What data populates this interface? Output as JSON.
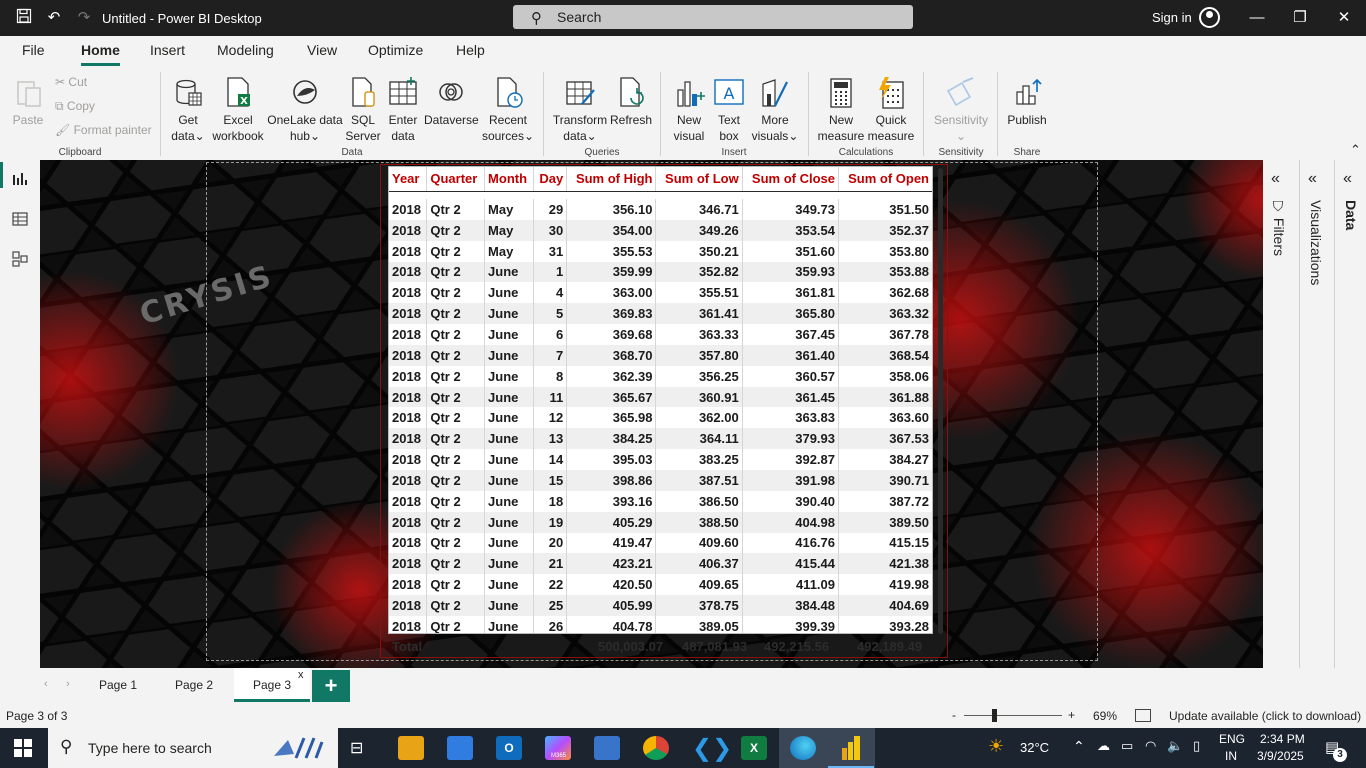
{
  "titlebar": {
    "app_title": "Untitled - Power BI Desktop",
    "search_placeholder": "Search",
    "sign_in": "Sign in"
  },
  "menu": {
    "tabs": [
      "File",
      "Home",
      "Insert",
      "Modeling",
      "View",
      "Optimize",
      "Help"
    ],
    "active": "Home"
  },
  "ribbon": {
    "clipboard": {
      "paste": "Paste",
      "cut": "Cut",
      "copy": "Copy",
      "format_painter": "Format painter",
      "label": "Clipboard"
    },
    "data": {
      "get_data": [
        "Get",
        "data"
      ],
      "excel": [
        "Excel",
        "workbook"
      ],
      "onelake": [
        "OneLake data",
        "hub"
      ],
      "sql": [
        "SQL",
        "Server"
      ],
      "enter": [
        "Enter",
        "data"
      ],
      "dataverse": [
        "Dataverse"
      ],
      "recent": [
        "Recent",
        "sources"
      ],
      "label": "Data"
    },
    "queries": {
      "transform": [
        "Transform",
        "data"
      ],
      "refresh": [
        "Refresh"
      ],
      "label": "Queries"
    },
    "insert": {
      "new_visual": [
        "New",
        "visual"
      ],
      "text_box": [
        "Text",
        "box"
      ],
      "more_visuals": [
        "More",
        "visuals"
      ],
      "label": "Insert"
    },
    "calculations": {
      "new_measure": [
        "New",
        "measure"
      ],
      "quick_measure": [
        "Quick",
        "measure"
      ],
      "label": "Calculations"
    },
    "sensitivity": {
      "sensitivity": [
        "Sensitivity"
      ],
      "label": "Sensitivity"
    },
    "share": {
      "publish": [
        "Publish"
      ],
      "label": "Share"
    }
  },
  "watermark": "CRYSIS",
  "table": {
    "columns": [
      "Year",
      "Quarter",
      "Month",
      "Day",
      "Sum of High",
      "Sum of Low",
      "Sum of Close",
      "Sum of Open"
    ],
    "rows": [
      [
        "2018",
        "Qtr 2",
        "May",
        "29",
        "356.10",
        "346.71",
        "349.73",
        "351.50"
      ],
      [
        "2018",
        "Qtr 2",
        "May",
        "30",
        "354.00",
        "349.26",
        "353.54",
        "352.37"
      ],
      [
        "2018",
        "Qtr 2",
        "May",
        "31",
        "355.53",
        "350.21",
        "351.60",
        "353.80"
      ],
      [
        "2018",
        "Qtr 2",
        "June",
        "1",
        "359.99",
        "352.82",
        "359.93",
        "353.88"
      ],
      [
        "2018",
        "Qtr 2",
        "June",
        "4",
        "363.00",
        "355.51",
        "361.81",
        "362.68"
      ],
      [
        "2018",
        "Qtr 2",
        "June",
        "5",
        "369.83",
        "361.41",
        "365.80",
        "363.32"
      ],
      [
        "2018",
        "Qtr 2",
        "June",
        "6",
        "369.68",
        "363.33",
        "367.45",
        "367.78"
      ],
      [
        "2018",
        "Qtr 2",
        "June",
        "7",
        "368.70",
        "357.80",
        "361.40",
        "368.54"
      ],
      [
        "2018",
        "Qtr 2",
        "June",
        "8",
        "362.39",
        "356.25",
        "360.57",
        "358.06"
      ],
      [
        "2018",
        "Qtr 2",
        "June",
        "11",
        "365.67",
        "360.91",
        "361.45",
        "361.88"
      ],
      [
        "2018",
        "Qtr 2",
        "June",
        "12",
        "365.98",
        "362.00",
        "363.83",
        "363.60"
      ],
      [
        "2018",
        "Qtr 2",
        "June",
        "13",
        "384.25",
        "364.11",
        "379.93",
        "367.53"
      ],
      [
        "2018",
        "Qtr 2",
        "June",
        "14",
        "395.03",
        "383.25",
        "392.87",
        "384.27"
      ],
      [
        "2018",
        "Qtr 2",
        "June",
        "15",
        "398.86",
        "387.51",
        "391.98",
        "390.71"
      ],
      [
        "2018",
        "Qtr 2",
        "June",
        "18",
        "393.16",
        "386.50",
        "390.40",
        "387.72"
      ],
      [
        "2018",
        "Qtr 2",
        "June",
        "19",
        "405.29",
        "388.50",
        "404.98",
        "389.50"
      ],
      [
        "2018",
        "Qtr 2",
        "June",
        "20",
        "419.47",
        "409.60",
        "416.76",
        "415.15"
      ],
      [
        "2018",
        "Qtr 2",
        "June",
        "21",
        "423.21",
        "406.37",
        "415.44",
        "421.38"
      ],
      [
        "2018",
        "Qtr 2",
        "June",
        "22",
        "420.50",
        "409.65",
        "411.09",
        "419.98"
      ],
      [
        "2018",
        "Qtr 2",
        "June",
        "25",
        "405.99",
        "378.75",
        "384.48",
        "404.69"
      ],
      [
        "2018",
        "Qtr 2",
        "June",
        "26",
        "404.78",
        "389.05",
        "399.39",
        "393.28"
      ]
    ],
    "total": {
      "label": "Total",
      "high": "500,003.07",
      "low": "487,081.93",
      "close": "492,215.56",
      "open": "492,189.49"
    }
  },
  "panes": {
    "filters": "Filters",
    "visualizations": "Visualizations",
    "data": "Data"
  },
  "pages": {
    "tabs": [
      "Page 1",
      "Page 2",
      "Page 3"
    ],
    "active": "Page 3",
    "add": "+",
    "close": "x"
  },
  "status": {
    "page_info": "Page 3 of 3",
    "zoom_minus": "-",
    "zoom_plus": "+",
    "zoom": "69%",
    "update": "Update available (click to download)"
  },
  "taskbar": {
    "search_placeholder": "Type here to search",
    "weather": "32°C",
    "lang1": "ENG",
    "lang2": "IN",
    "time": "2:34 PM",
    "date": "3/9/2025",
    "notifications": "3",
    "m365": "M365"
  },
  "colors": {
    "accent": "#117865",
    "header_text": "#c00000",
    "canvas_bg": "#0e0e0f",
    "glow": "#d01010"
  }
}
